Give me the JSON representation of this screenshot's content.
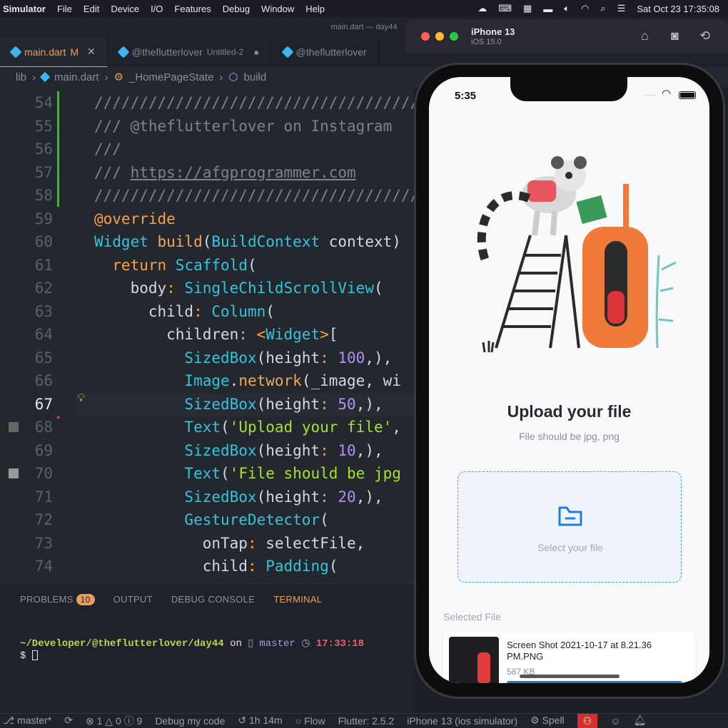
{
  "menubar": {
    "app": "Simulator",
    "items": [
      "File",
      "Edit",
      "Device",
      "I/O",
      "Features",
      "Debug",
      "Window",
      "Help"
    ],
    "clock": "Sat Oct 23  17:35:08"
  },
  "vscode": {
    "window_title": "main.dart — day44",
    "tabs": [
      {
        "label": "main.dart",
        "marker": "M"
      },
      {
        "label": "@theflutterlover",
        "extra": "Untitled-2"
      },
      {
        "label": "@theflutterlover"
      }
    ],
    "breadcrumbs": [
      "lib",
      "main.dart",
      "_HomePageState",
      "build"
    ],
    "current_line": "67",
    "lines": [
      {
        "n": "54",
        "segs": [
          {
            "t": "////////////////////////////////////",
            "c": "cm"
          }
        ]
      },
      {
        "n": "55",
        "segs": [
          {
            "t": "/// @theflutterlover on Instagram",
            "c": "cm"
          }
        ]
      },
      {
        "n": "56",
        "segs": [
          {
            "t": "///",
            "c": "cm"
          }
        ]
      },
      {
        "n": "57",
        "segs": [
          {
            "t": "/// ",
            "c": "cm"
          },
          {
            "t": "https://afgprogrammer.com",
            "c": "cm"
          }
        ]
      },
      {
        "n": "58",
        "segs": [
          {
            "t": "////////////////////////////////////",
            "c": "cm"
          }
        ]
      },
      {
        "n": "59",
        "segs": [
          {
            "t": "@override",
            "c": "k"
          }
        ]
      },
      {
        "n": "60",
        "segs": [
          {
            "t": "Widget ",
            "c": "c"
          },
          {
            "t": "build",
            "c": "f"
          },
          {
            "t": "(",
            "c": "w"
          },
          {
            "t": "BuildContext",
            "c": "c"
          },
          {
            "t": " context)",
            "c": "w"
          }
        ]
      },
      {
        "n": "61",
        "segs": [
          {
            "t": "  return ",
            "c": "k"
          },
          {
            "t": "Scaffold",
            "c": "c"
          },
          {
            "t": "(",
            "c": "w"
          }
        ]
      },
      {
        "n": "62",
        "segs": [
          {
            "t": "    body",
            "c": "w"
          },
          {
            "t": ": ",
            "c": "k"
          },
          {
            "t": "SingleChildScrollView",
            "c": "c"
          },
          {
            "t": "(",
            "c": "w"
          }
        ]
      },
      {
        "n": "63",
        "segs": [
          {
            "t": "      child",
            "c": "w"
          },
          {
            "t": ": ",
            "c": "k"
          },
          {
            "t": "Column",
            "c": "c"
          },
          {
            "t": "(",
            "c": "w"
          }
        ]
      },
      {
        "n": "64",
        "segs": [
          {
            "t": "        children",
            "c": "w"
          },
          {
            "t": ": <",
            "c": "k"
          },
          {
            "t": "Widget",
            "c": "c"
          },
          {
            "t": ">",
            "c": "k"
          },
          {
            "t": "[",
            "c": "w"
          }
        ]
      },
      {
        "n": "65",
        "segs": [
          {
            "t": "          SizedBox",
            "c": "c"
          },
          {
            "t": "(height",
            "c": "w"
          },
          {
            "t": ": ",
            "c": "k"
          },
          {
            "t": "100",
            "c": "n"
          },
          {
            "t": ",),",
            "c": "w"
          }
        ]
      },
      {
        "n": "66",
        "segs": [
          {
            "t": "          Image",
            "c": "c"
          },
          {
            "t": ".",
            "c": "w"
          },
          {
            "t": "network",
            "c": "f"
          },
          {
            "t": "(_image, wi",
            "c": "w"
          }
        ]
      },
      {
        "n": "67",
        "segs": [
          {
            "t": "          SizedBox",
            "c": "c"
          },
          {
            "t": "(height",
            "c": "w"
          },
          {
            "t": ": ",
            "c": "k"
          },
          {
            "t": "50",
            "c": "n"
          },
          {
            "t": ",),",
            "c": "w"
          }
        ]
      },
      {
        "n": "68",
        "segs": [
          {
            "t": "          Text",
            "c": "c"
          },
          {
            "t": "(",
            "c": "w"
          },
          {
            "t": "'Upload your file'",
            "c": "s"
          },
          {
            "t": ",",
            "c": "w"
          }
        ]
      },
      {
        "n": "69",
        "segs": [
          {
            "t": "          SizedBox",
            "c": "c"
          },
          {
            "t": "(height",
            "c": "w"
          },
          {
            "t": ": ",
            "c": "k"
          },
          {
            "t": "10",
            "c": "n"
          },
          {
            "t": ",),",
            "c": "w"
          }
        ]
      },
      {
        "n": "70",
        "segs": [
          {
            "t": "          Text",
            "c": "c"
          },
          {
            "t": "(",
            "c": "w"
          },
          {
            "t": "'File should be jpg",
            "c": "s"
          }
        ]
      },
      {
        "n": "71",
        "segs": [
          {
            "t": "          SizedBox",
            "c": "c"
          },
          {
            "t": "(height",
            "c": "w"
          },
          {
            "t": ": ",
            "c": "k"
          },
          {
            "t": "20",
            "c": "n"
          },
          {
            "t": ",),",
            "c": "w"
          }
        ]
      },
      {
        "n": "72",
        "segs": [
          {
            "t": "          GestureDetector",
            "c": "c"
          },
          {
            "t": "(",
            "c": "w"
          }
        ]
      },
      {
        "n": "73",
        "segs": [
          {
            "t": "            onTap",
            "c": "w"
          },
          {
            "t": ": ",
            "c": "k"
          },
          {
            "t": "selectFile,",
            "c": "w"
          }
        ]
      },
      {
        "n": "74",
        "segs": [
          {
            "t": "            child",
            "c": "w"
          },
          {
            "t": ": ",
            "c": "k"
          },
          {
            "t": "Padding",
            "c": "c"
          },
          {
            "t": "(",
            "c": "w"
          }
        ]
      }
    ],
    "panel_tabs": [
      "PROBLEMS",
      "OUTPUT",
      "DEBUG CONSOLE",
      "TERMINAL"
    ],
    "problems_count": "10",
    "terminal_path": "~/Developer/@theflutterlover/day44",
    "terminal_on": "on",
    "terminal_branch": "master",
    "terminal_time": "17:33:18",
    "terminal_prompt": "$",
    "status": {
      "branch": "master*",
      "counts": "⊗ 1 △ 0 ⓘ 9",
      "debug": "Debug my code",
      "timer": "1h 14m",
      "flow": "Flow",
      "flutter": "Flutter: 2.5.2",
      "device": "iPhone 13 (ios simulator)",
      "spell": "Spell"
    }
  },
  "simulator": {
    "device_name": "iPhone 13",
    "os": "iOS 15.0",
    "status_time": "5:35",
    "title": "Upload your file",
    "subtitle": "File should be jpg, png",
    "dropzone_label": "Select your file",
    "selected_label": "Selected File",
    "file_name": "Screen Shot 2021-10-17 at 8.21.36 PM.PNG",
    "file_size": "587 KB",
    "progress": 1.0
  },
  "colors": {
    "accent_orange": "#e8a060",
    "dart_blue": "#3fb6f4",
    "upload_blue": "#1a7fe0"
  }
}
